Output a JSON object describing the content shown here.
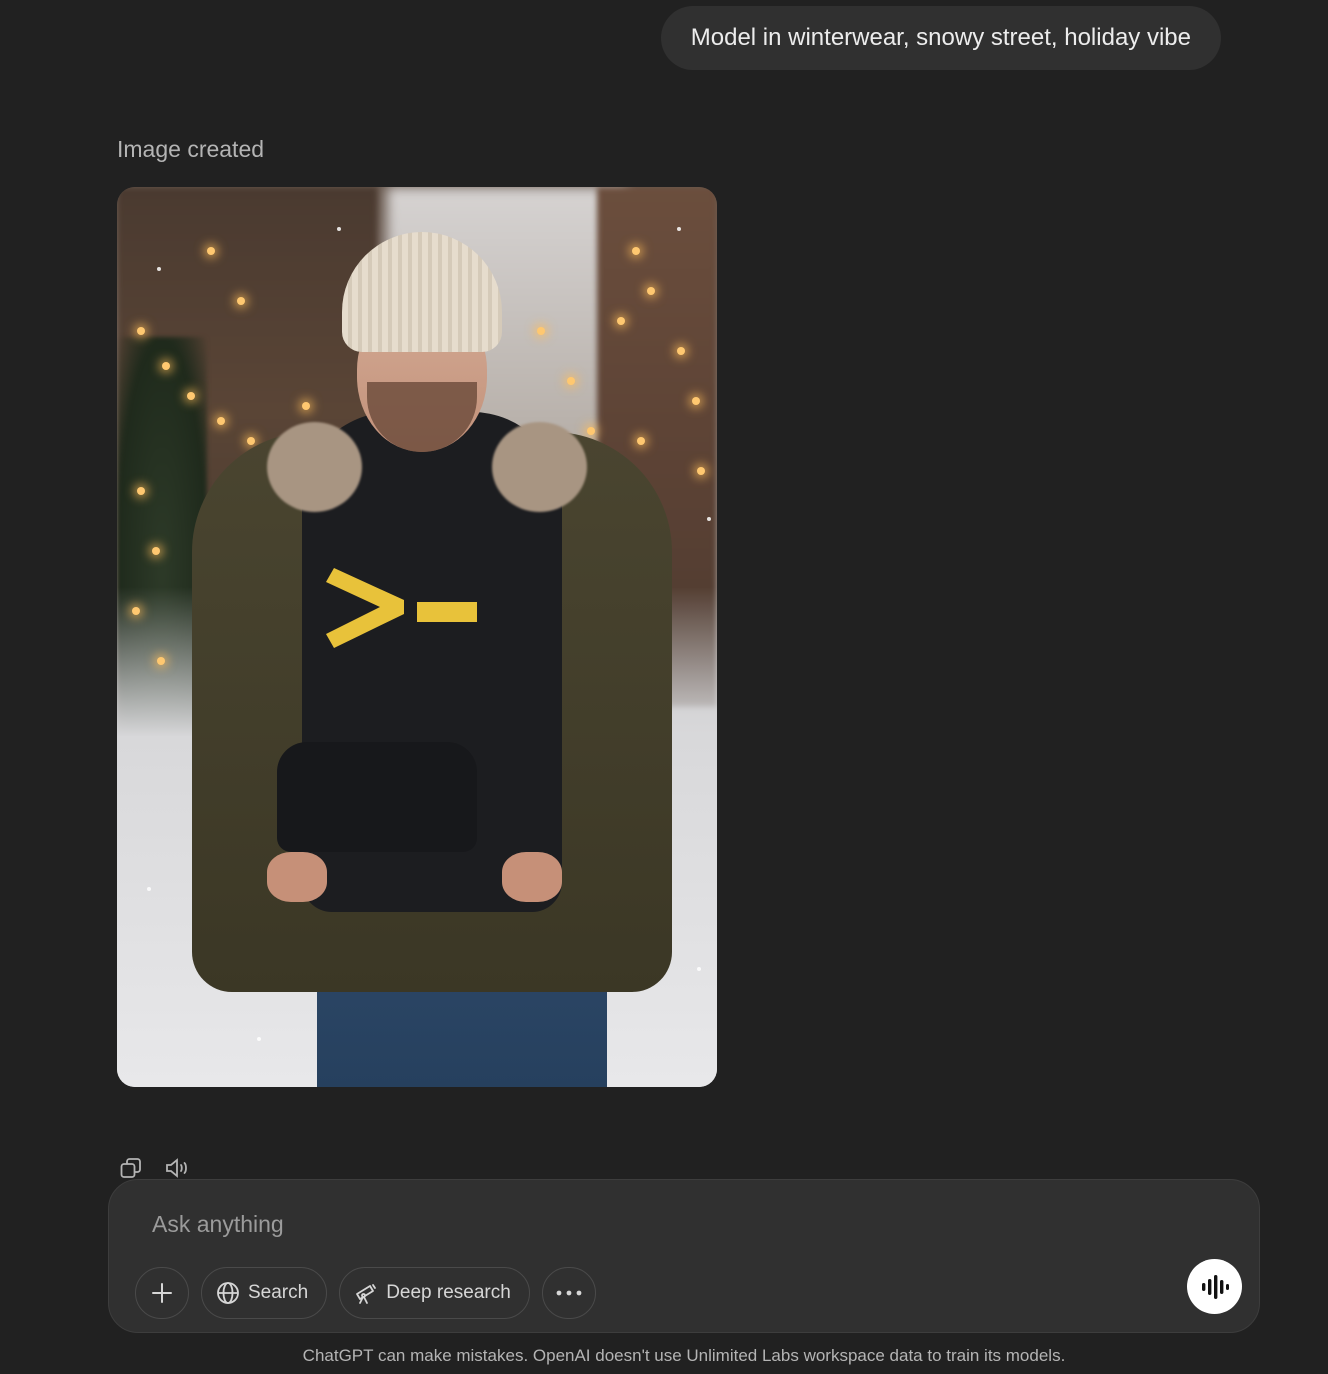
{
  "conversation": {
    "user_message": "Model in winterwear, snowy street, holiday vibe",
    "assistant_status": "Image created",
    "generated_image": {
      "alt": "Model in winterwear, snowy street, holiday vibe",
      "hoodie_logo": ">_"
    }
  },
  "message_actions": [
    {
      "name": "copy-icon"
    },
    {
      "name": "read-aloud-icon"
    }
  ],
  "composer": {
    "placeholder": "Ask anything",
    "value": "",
    "tools": {
      "add_icon": "plus-icon",
      "search_label": "Search",
      "search_icon": "globe-icon",
      "deep_research_label": "Deep research",
      "deep_research_icon": "telescope-icon",
      "more_icon": "ellipsis-icon"
    },
    "voice_icon": "voice-mode-icon"
  },
  "footer": {
    "disclaimer": "ChatGPT can make mistakes. OpenAI doesn't use Unlimited Labs workspace data to train its models."
  },
  "colors": {
    "background": "#212121",
    "bubble": "#303030",
    "logo_yellow": "#e8c23a"
  }
}
